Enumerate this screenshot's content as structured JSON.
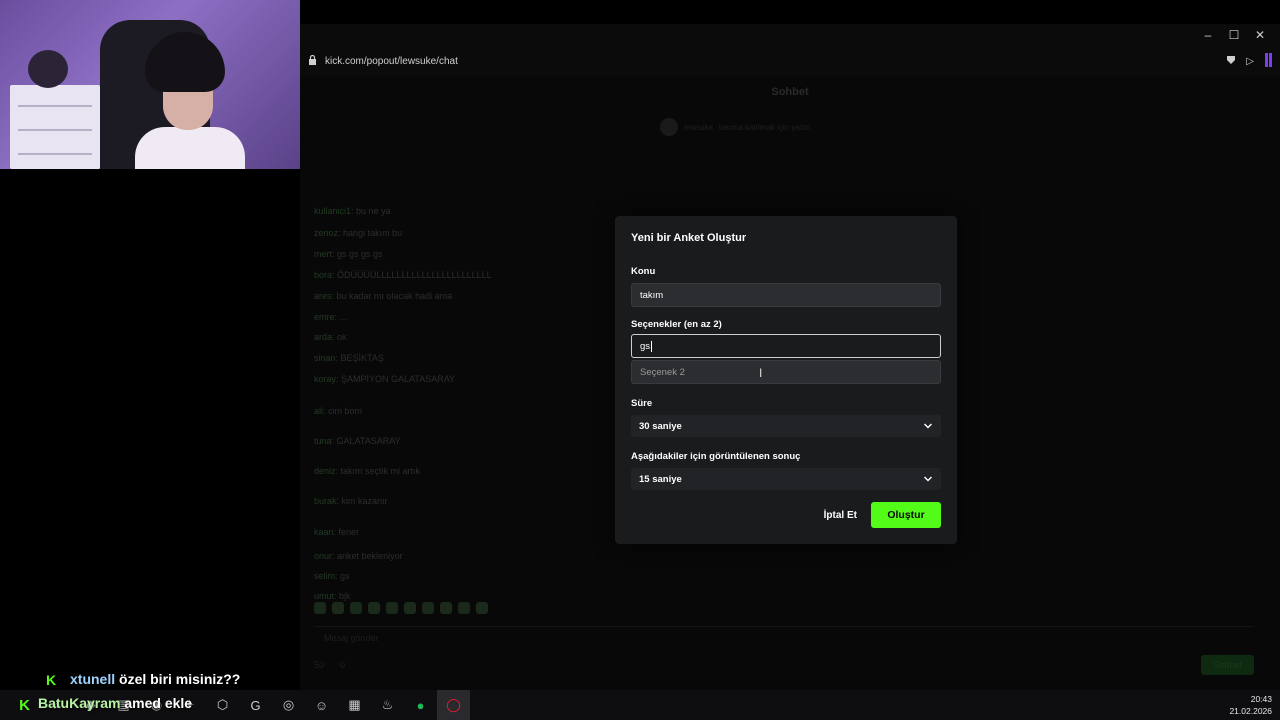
{
  "browser": {
    "url": "kick.com/popout/lewsuke/chat"
  },
  "chat": {
    "title": "Sohbet",
    "pinned_name": "lewsuke",
    "pinned_text": "takıma katılmak için yazın",
    "messages": [
      {
        "user": "kullanici1",
        "text": "bu ne ya"
      },
      {
        "user": "zenoz",
        "text": "hangi takım bu"
      },
      {
        "user": "mert",
        "text": "gs gs gs gs"
      },
      {
        "user": "bora",
        "text": "ÖDÜÜÜÜLLLLLLLLLLLLLLLLLLLLLLL"
      },
      {
        "user": "ares",
        "text": "bu kadar mı olacak hadi ama"
      },
      {
        "user": "emre",
        "text": "..."
      },
      {
        "user": "arda",
        "text": "ok"
      },
      {
        "user": "sinan",
        "text": "BEŞİKTAŞ"
      },
      {
        "user": "koray",
        "text": "ŞAMPİYON GALATASARAY"
      },
      {
        "user": "ali",
        "text": "cim bom"
      },
      {
        "user": "tuna",
        "text": "GALATASARAY"
      },
      {
        "user": "deniz",
        "text": "takım seçtik mi artık"
      },
      {
        "user": "burak",
        "text": "kim kazanır"
      },
      {
        "user": "kaan",
        "text": "fener"
      },
      {
        "user": "onur",
        "text": "anket bekleniyor"
      },
      {
        "user": "selim",
        "text": "gs"
      },
      {
        "user": "umut",
        "text": "bjk"
      }
    ],
    "input_placeholder": "Mesaj gönder",
    "bottom_count_1": "50",
    "bottom_count_2": "0",
    "send_label": "Sohbet"
  },
  "modal": {
    "title": "Yeni bir Anket Oluştur",
    "topic_label": "Konu",
    "topic_value": "takım",
    "options_label": "Seçenekler (en az 2)",
    "option1_value": "gs",
    "option2_placeholder": "Seçenek 2",
    "duration_label": "Süre",
    "duration_value": "30 saniye",
    "result_label": "Aşağıdakiler için görüntülenen sonuç",
    "result_value": "15 saniye",
    "cancel_label": "İptal Et",
    "create_label": "Oluştur"
  },
  "overlay": {
    "line1_user": "xtunell",
    "line1_text": "özel biri misiniz??",
    "line2_user": "BatuKayram",
    "line2_text": "amed ekle"
  },
  "taskbar": {
    "time": "20:43",
    "date": "21.02.2026"
  },
  "colors": {
    "accent": "#53fc18",
    "modal_bg": "#1a1b1d",
    "page_bg": "#0b0b0c"
  }
}
